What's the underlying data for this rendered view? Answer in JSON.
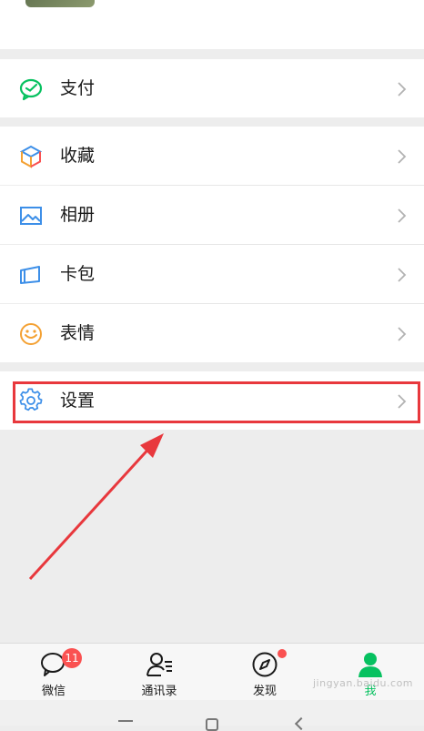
{
  "menu": {
    "pay": "支付",
    "favorites": "收藏",
    "album": "相册",
    "cards": "卡包",
    "stickers": "表情",
    "settings": "设置"
  },
  "tabs": {
    "chats": "微信",
    "contacts": "通讯录",
    "discover": "发现",
    "me": "我",
    "chats_badge": "11"
  },
  "colors": {
    "wechat_green": "#07c160",
    "highlight_red": "#e8383d",
    "badge_red": "#fa5151",
    "icon_blue": "#3d8fe8",
    "icon_orange": "#f4a133"
  },
  "watermark": "jingyan.baidu.com"
}
